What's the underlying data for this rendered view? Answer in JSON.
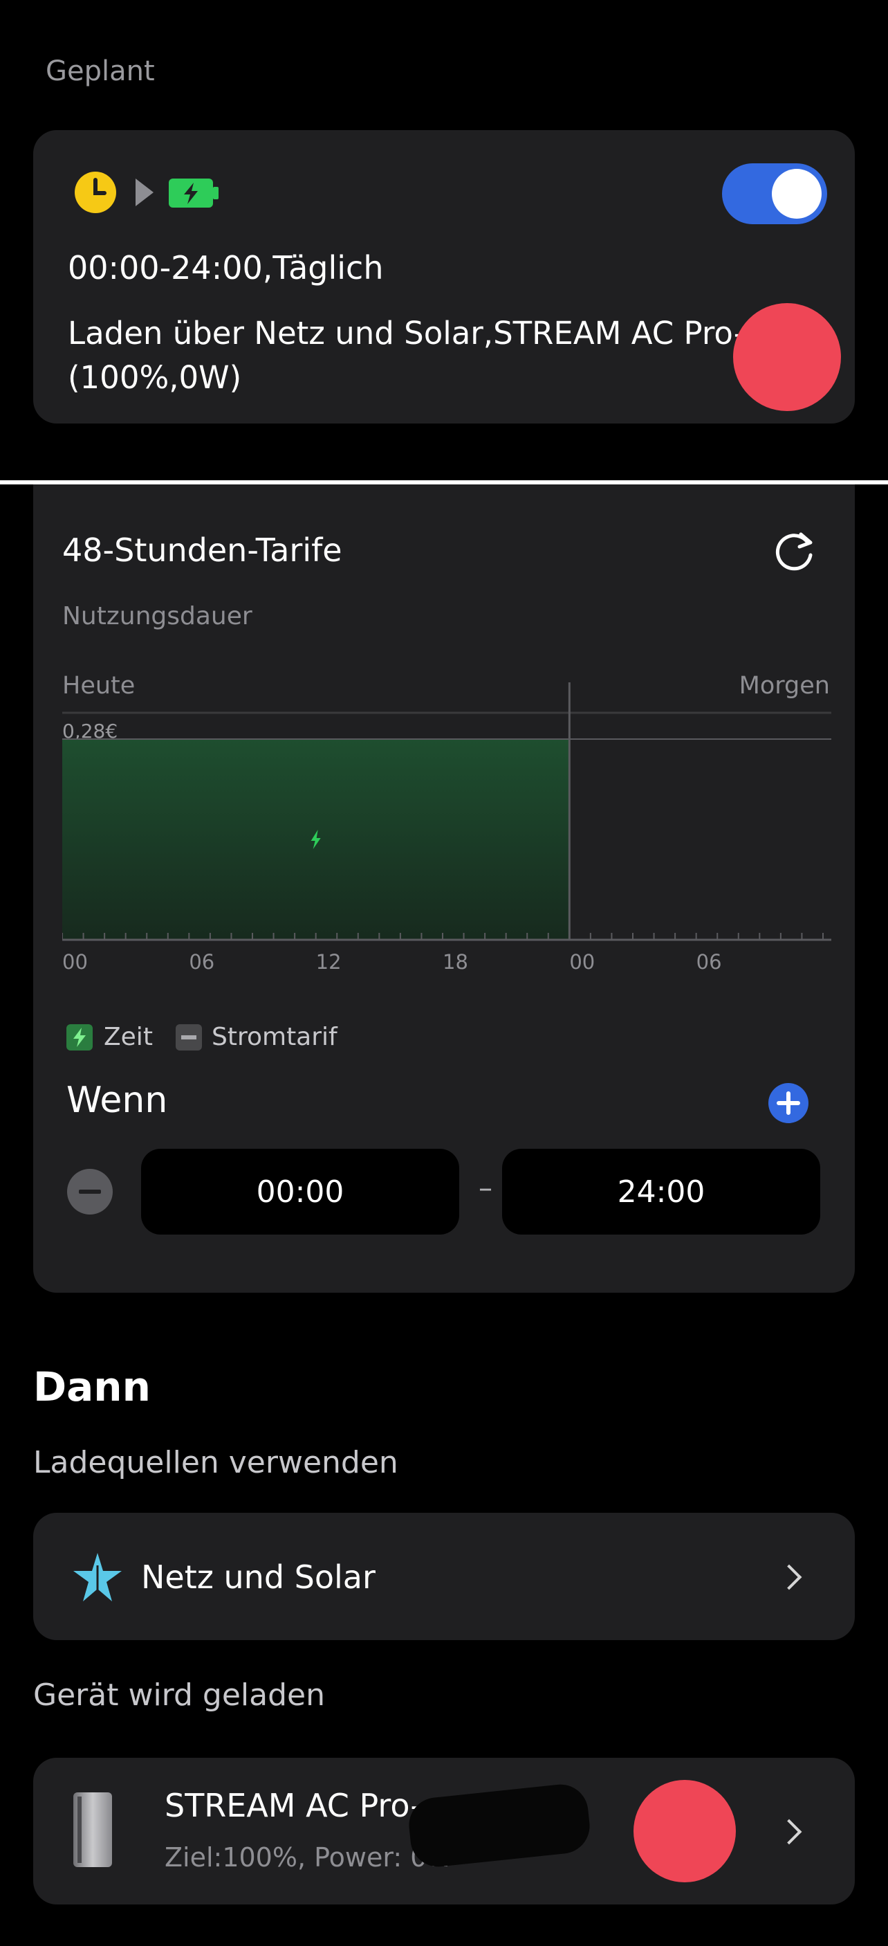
{
  "scheduled": {
    "section_title": "Geplant",
    "toggle_on": true,
    "time_range": "00:00-24:00,Täglich",
    "description_line1": "Laden über Netz und Solar,STREAM AC Pro-",
    "description_line2": "(100%,0W)"
  },
  "tariff": {
    "title": "48-Stunden-Tarife",
    "subtitle": "Nutzungsdauer",
    "label_today": "Heute",
    "label_tomorrow": "Morgen",
    "price_label": "0,28€",
    "legend_time": "Zeit",
    "legend_tariff": "Stromtarif",
    "accent_color": "#2ecc59"
  },
  "chart_data": {
    "type": "area",
    "x_ticks": [
      "00",
      "06",
      "12",
      "18",
      "00",
      "06"
    ],
    "series": [
      {
        "name": "Zeit",
        "start_hour": 0,
        "end_hour": 24
      }
    ],
    "price_line": 0.28,
    "y_label": "0,28€",
    "top_labels": [
      "Heute",
      "Morgen"
    ],
    "xlim": [
      0,
      36
    ]
  },
  "wenn": {
    "title": "Wenn",
    "start_time": "00:00",
    "separator": "–",
    "end_time": "24:00"
  },
  "dann": {
    "title": "Dann",
    "sources_label": "Ladequellen verwenden",
    "source_value": "Netz und Solar",
    "device_label": "Gerät wird geladen",
    "device_name": "STREAM AC Pro-",
    "device_detail": "Ziel:100%, Power: 0W"
  }
}
